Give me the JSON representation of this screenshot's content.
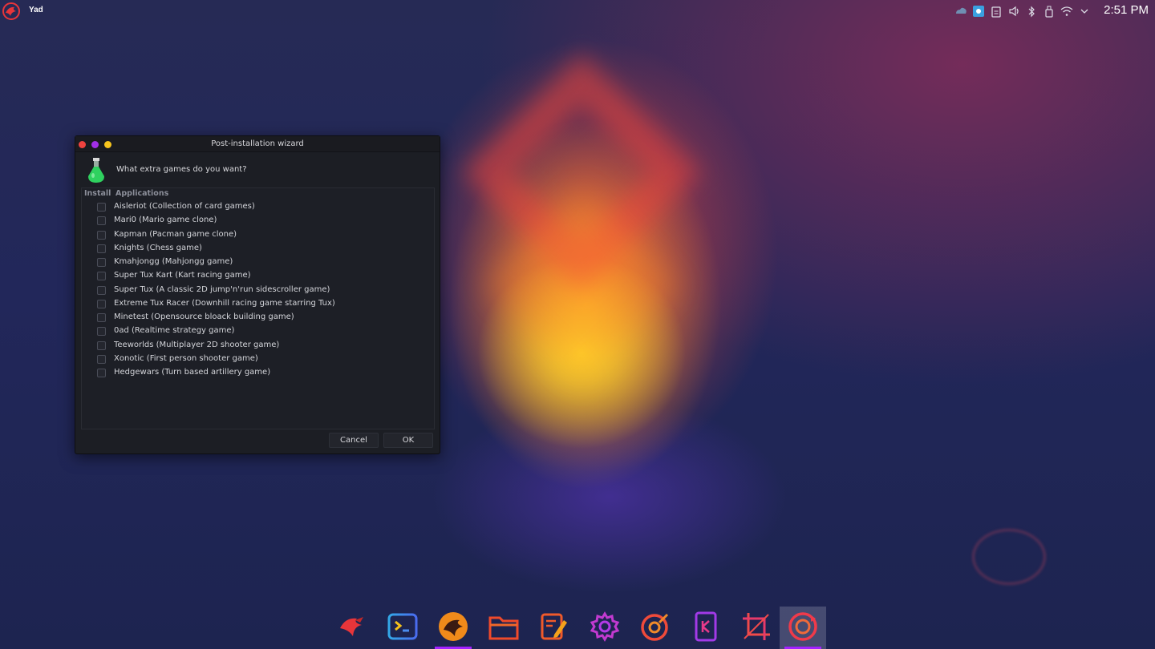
{
  "panel": {
    "app_name": "Yad",
    "clock": "2:51 PM",
    "tray_icons": [
      "cloud-icon",
      "screen-icon",
      "clipboard-icon",
      "volume-icon",
      "bluetooth-icon",
      "usb-icon",
      "wifi-icon",
      "chevron-down-icon"
    ]
  },
  "dialog": {
    "title": "Post-installation wizard",
    "question": "What extra games do you want?",
    "columns": {
      "install": "Install",
      "applications": "Applications"
    },
    "items": [
      {
        "label": "Aisleriot (Collection of card games)",
        "checked": false
      },
      {
        "label": "Mari0 (Mario game clone)",
        "checked": false
      },
      {
        "label": "Kapman (Pacman game clone)",
        "checked": false
      },
      {
        "label": "Knights (Chess game)",
        "checked": false
      },
      {
        "label": "Kmahjongg (Mahjongg game)",
        "checked": false
      },
      {
        "label": "Super Tux Kart (Kart racing game)",
        "checked": false
      },
      {
        "label": "Super Tux (A classic 2D jump'n'run sidescroller game)",
        "checked": false
      },
      {
        "label": "Extreme Tux Racer (Downhill racing game starring Tux)",
        "checked": false
      },
      {
        "label": "Minetest (Opensource bloack building game)",
        "checked": false
      },
      {
        "label": "0ad (Realtime strategy game)",
        "checked": false
      },
      {
        "label": "Teeworlds (Multiplayer 2D shooter game)",
        "checked": false
      },
      {
        "label": "Xonotic (First person shooter game)",
        "checked": false
      },
      {
        "label": "Hedgewars (Turn based artillery game)",
        "checked": false
      }
    ],
    "buttons": {
      "cancel": "Cancel",
      "ok": "OK"
    }
  },
  "dock": {
    "items": [
      {
        "name": "garuda-icon",
        "running": false,
        "active": false
      },
      {
        "name": "terminal-icon",
        "running": false,
        "active": false
      },
      {
        "name": "browser-icon",
        "running": true,
        "active": false
      },
      {
        "name": "folder-icon",
        "running": false,
        "active": false
      },
      {
        "name": "text-editor-icon",
        "running": false,
        "active": false
      },
      {
        "name": "settings-icon",
        "running": false,
        "active": false
      },
      {
        "name": "assistant-icon",
        "running": false,
        "active": false
      },
      {
        "name": "kdeconnect-icon",
        "running": false,
        "active": false
      },
      {
        "name": "screenshot-icon",
        "running": false,
        "active": false
      },
      {
        "name": "updater-icon",
        "running": true,
        "active": true
      }
    ]
  },
  "colors": {
    "accent": "#a321ff",
    "close": "#f0433f",
    "maximize": "#a22fe8",
    "minimize": "#f7c51d"
  }
}
